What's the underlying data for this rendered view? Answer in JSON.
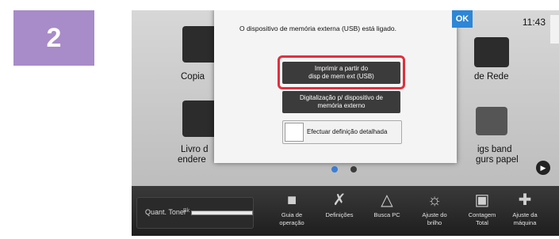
{
  "step_number": "2",
  "home": {
    "clock": "11:43",
    "tiles": {
      "copy": "Copia",
      "network": "de Rede",
      "address_book_1": "Livro d",
      "address_book_2": "endere",
      "tray_1": "igs band",
      "tray_2": "gurs papel"
    }
  },
  "dialog": {
    "message": "O dispositivo de memória externa (USB) está ligado.",
    "ok_label": "OK",
    "print_line1": "Imprimir a partir do",
    "print_line2": "disp de mem ext (USB)",
    "scan_line1": "Digitalização p/ dispositivo de",
    "scan_line2": "memória externo",
    "detail_label": "Efectuar definição detalhada"
  },
  "bottombar": {
    "toner_label": "Quant. Toner",
    "toner_channel": "Bk",
    "toner_level": 1.0,
    "tools": [
      {
        "line1": "Guia de",
        "line2": "operação",
        "icon": "guide-icon"
      },
      {
        "line1": "Definições",
        "line2": "",
        "icon": "settings-icon"
      },
      {
        "line1": "Busca PC",
        "line2": "",
        "icon": "search-pc-icon"
      },
      {
        "line1": "Ajuste do",
        "line2": "brilho",
        "icon": "brightness-icon"
      },
      {
        "line1": "Contagem",
        "line2": "Total",
        "icon": "counter-icon"
      },
      {
        "line1": "Ajuste da",
        "line2": "máquina",
        "icon": "machine-adjust-icon"
      }
    ]
  }
}
